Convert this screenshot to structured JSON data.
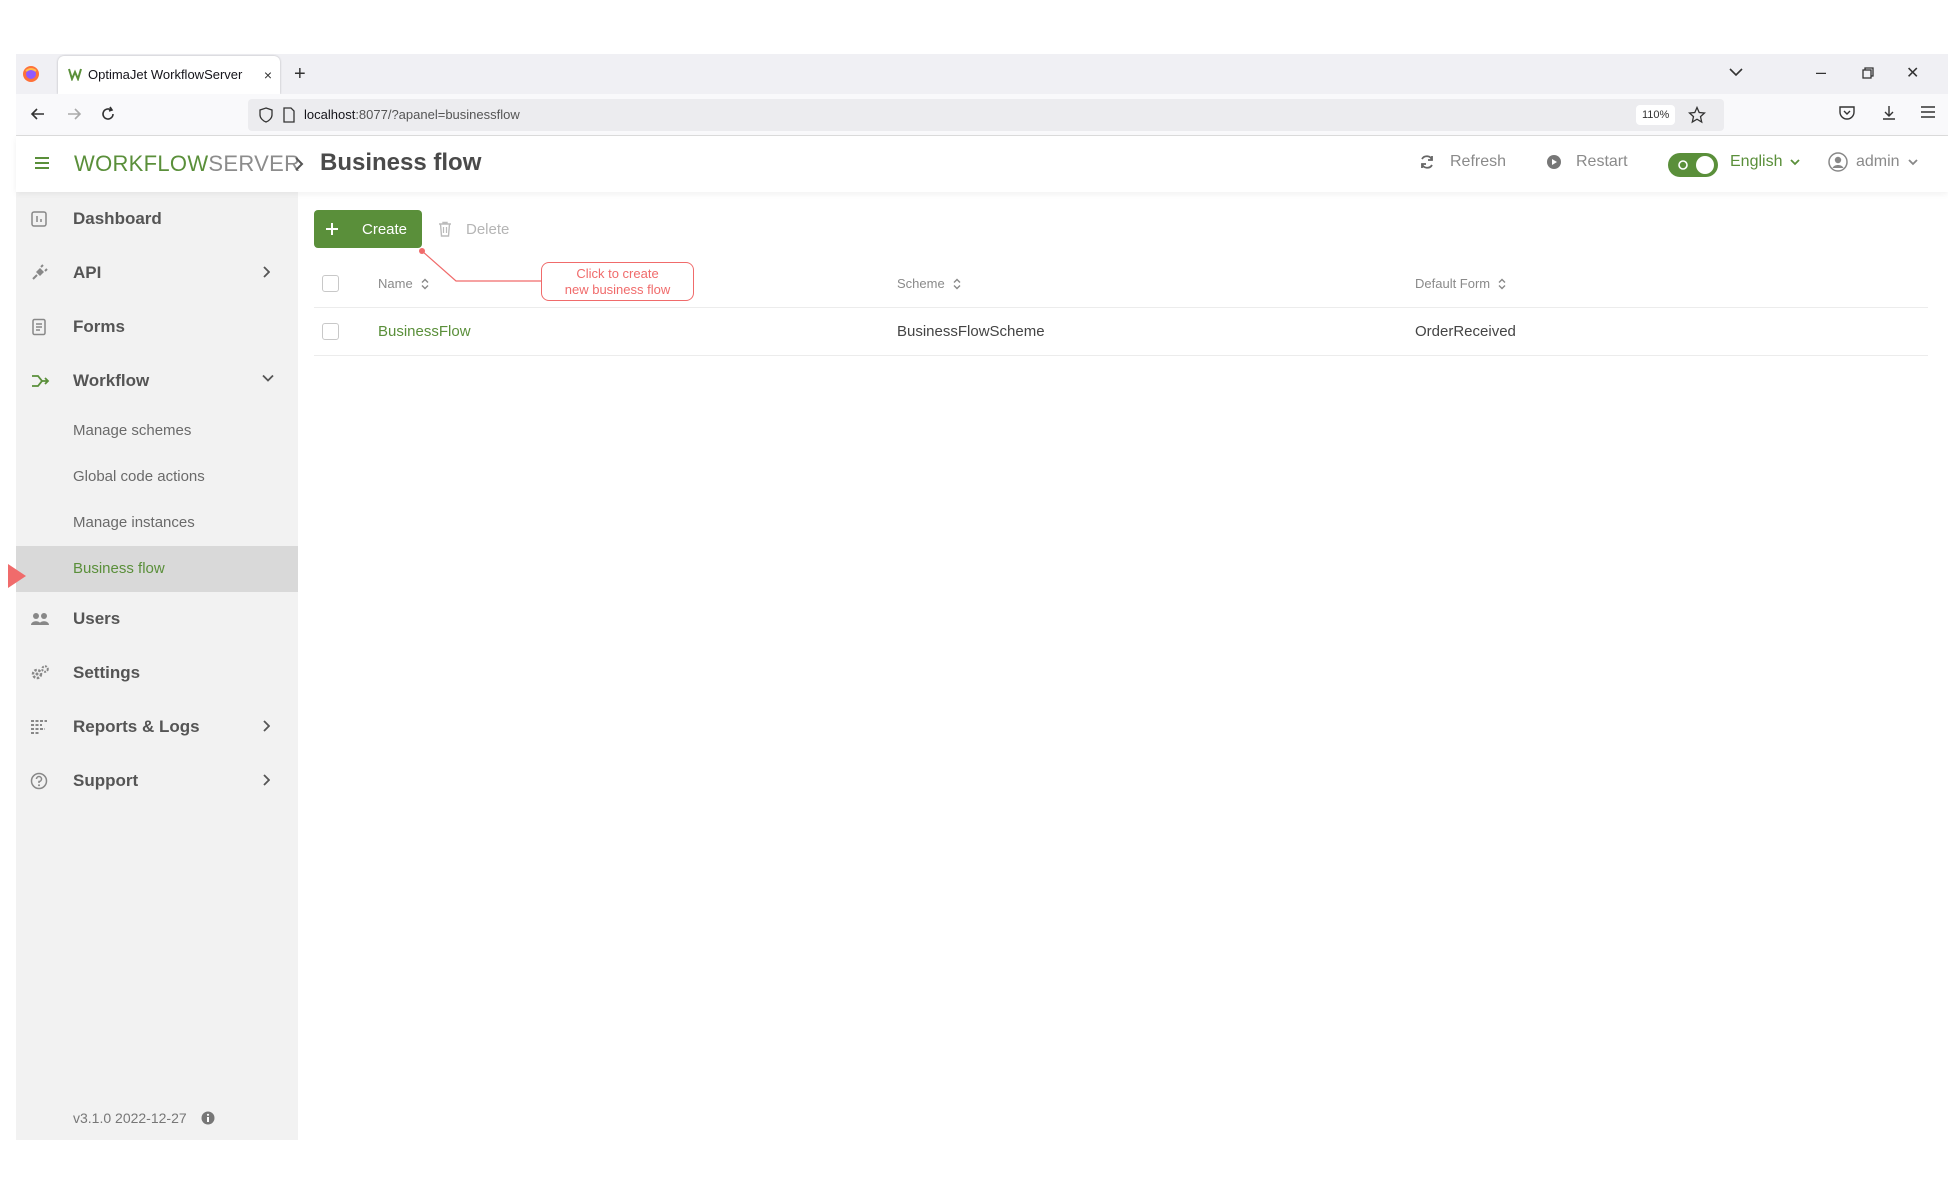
{
  "browser": {
    "tab_title": "OptimaJet WorkflowServer",
    "tab_close": "×",
    "new_tab": "+",
    "url_host": "localhost",
    "url_rest": ":8077/?apanel=businessflow",
    "zoom": "110%",
    "window_min": "–",
    "window_close": "✕"
  },
  "header": {
    "logo_workflow": "WORKFLOW",
    "logo_server": "SERVER",
    "page_title": "Business flow",
    "refresh_label": "Refresh",
    "restart_label": "Restart",
    "language": "English",
    "user": "admin"
  },
  "sidebar": {
    "items": [
      {
        "label": "Dashboard",
        "icon": "dashboard-icon"
      },
      {
        "label": "API",
        "icon": "plug-icon"
      },
      {
        "label": "Forms",
        "icon": "forms-icon"
      },
      {
        "label": "Workflow",
        "icon": "workflow-icon"
      },
      {
        "label": "Users",
        "icon": "users-icon"
      },
      {
        "label": "Settings",
        "icon": "gears-icon"
      },
      {
        "label": "Reports & Logs",
        "icon": "reports-icon"
      },
      {
        "label": "Support",
        "icon": "question-icon"
      }
    ],
    "workflow_sub": [
      {
        "label": "Manage schemes"
      },
      {
        "label": "Global code actions"
      },
      {
        "label": "Manage instances"
      },
      {
        "label": "Business flow"
      }
    ],
    "version": "v3.1.0 2022-12-27"
  },
  "toolbar": {
    "create_label": "Create",
    "delete_label": "Delete"
  },
  "table": {
    "columns": [
      "Name",
      "Scheme",
      "Default Form"
    ],
    "rows": [
      {
        "name": "BusinessFlow",
        "scheme": "BusinessFlowScheme",
        "form": "OrderReceived"
      }
    ]
  },
  "callout": {
    "line1": "Click to create",
    "line2": "new business flow"
  },
  "colors": {
    "accent": "#5a8f3a",
    "callout": "#f06b6b",
    "sidebar_bg": "#f2f2f2",
    "active_bg": "#d9d9d9"
  }
}
